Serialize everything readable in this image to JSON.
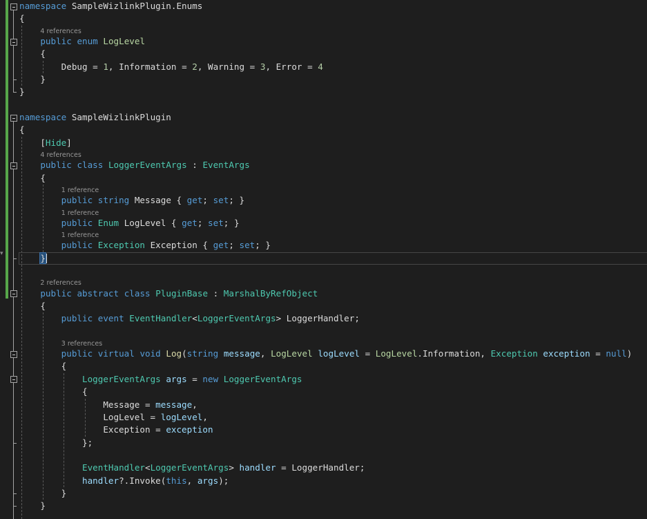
{
  "editor": {
    "colors": {
      "background": "#1e1e1e",
      "keyword": "#569cd6",
      "type": "#4ec9b0",
      "enum": "#b8d7a3",
      "method": "#dcdcaa",
      "identifier": "#9cdcfe",
      "number": "#b5cea8",
      "text": "#dcdcdc",
      "changed_bar": "#57a64a"
    },
    "current_line": 21,
    "lines": [
      {
        "type": "code",
        "fold": true,
        "tokens": [
          [
            "k",
            "namespace"
          ],
          [
            "d",
            " SampleWizlinkPlugin.Enums"
          ]
        ]
      },
      {
        "type": "code",
        "tokens": [
          [
            "d",
            "{"
          ]
        ]
      },
      {
        "type": "lens",
        "text": "    4 references"
      },
      {
        "type": "code",
        "fold": true,
        "tokens": [
          [
            "d",
            "    "
          ],
          [
            "k",
            "public"
          ],
          [
            "d",
            " "
          ],
          [
            "k",
            "enum"
          ],
          [
            "d",
            " "
          ],
          [
            "e",
            "LogLevel"
          ]
        ]
      },
      {
        "type": "code",
        "tokens": [
          [
            "d",
            "    {"
          ]
        ]
      },
      {
        "type": "code",
        "tokens": [
          [
            "d",
            "        Debug = "
          ],
          [
            "n",
            "1"
          ],
          [
            "d",
            ", Information = "
          ],
          [
            "n",
            "2"
          ],
          [
            "d",
            ", Warning = "
          ],
          [
            "n",
            "3"
          ],
          [
            "d",
            ", Error = "
          ],
          [
            "n",
            "4"
          ]
        ]
      },
      {
        "type": "code",
        "tokens": [
          [
            "d",
            "    }"
          ]
        ]
      },
      {
        "type": "code",
        "tokens": [
          [
            "d",
            "}"
          ]
        ]
      },
      {
        "type": "blank",
        "tokens": []
      },
      {
        "type": "code",
        "fold": true,
        "tokens": [
          [
            "k",
            "namespace"
          ],
          [
            "d",
            " SampleWizlinkPlugin"
          ]
        ]
      },
      {
        "type": "code",
        "tokens": [
          [
            "d",
            "{"
          ]
        ]
      },
      {
        "type": "code",
        "tokens": [
          [
            "d",
            "    ["
          ],
          [
            "t",
            "Hide"
          ],
          [
            "d",
            "]"
          ]
        ]
      },
      {
        "type": "lens",
        "text": "    4 references"
      },
      {
        "type": "code",
        "fold": true,
        "tokens": [
          [
            "d",
            "    "
          ],
          [
            "k",
            "public"
          ],
          [
            "d",
            " "
          ],
          [
            "k",
            "class"
          ],
          [
            "d",
            " "
          ],
          [
            "t",
            "LoggerEventArgs"
          ],
          [
            "d",
            " : "
          ],
          [
            "t",
            "EventArgs"
          ]
        ]
      },
      {
        "type": "code",
        "tokens": [
          [
            "d",
            "    {"
          ]
        ]
      },
      {
        "type": "lens",
        "text": "        1 reference"
      },
      {
        "type": "code",
        "tokens": [
          [
            "d",
            "        "
          ],
          [
            "k",
            "public"
          ],
          [
            "d",
            " "
          ],
          [
            "k",
            "string"
          ],
          [
            "d",
            " Message { "
          ],
          [
            "k",
            "get"
          ],
          [
            "d",
            "; "
          ],
          [
            "k",
            "set"
          ],
          [
            "d",
            "; }"
          ]
        ]
      },
      {
        "type": "lens",
        "text": "        1 reference"
      },
      {
        "type": "code",
        "tokens": [
          [
            "d",
            "        "
          ],
          [
            "k",
            "public"
          ],
          [
            "d",
            " "
          ],
          [
            "t",
            "Enum"
          ],
          [
            "d",
            " LogLevel { "
          ],
          [
            "k",
            "get"
          ],
          [
            "d",
            "; "
          ],
          [
            "k",
            "set"
          ],
          [
            "d",
            "; }"
          ]
        ]
      },
      {
        "type": "lens",
        "text": "        1 reference"
      },
      {
        "type": "code",
        "tokens": [
          [
            "d",
            "        "
          ],
          [
            "k",
            "public"
          ],
          [
            "d",
            " "
          ],
          [
            "t",
            "Exception"
          ],
          [
            "d",
            " Exception { "
          ],
          [
            "k",
            "get"
          ],
          [
            "d",
            "; "
          ],
          [
            "k",
            "set"
          ],
          [
            "d",
            "; }"
          ]
        ]
      },
      {
        "type": "code",
        "tokens": [
          [
            "d",
            "    "
          ],
          [
            "hl",
            "}"
          ]
        ]
      },
      {
        "type": "blank",
        "tokens": []
      },
      {
        "type": "lens",
        "text": "    2 references"
      },
      {
        "type": "code",
        "fold": true,
        "tokens": [
          [
            "d",
            "    "
          ],
          [
            "k",
            "public"
          ],
          [
            "d",
            " "
          ],
          [
            "k",
            "abstract"
          ],
          [
            "d",
            " "
          ],
          [
            "k",
            "class"
          ],
          [
            "d",
            " "
          ],
          [
            "t",
            "PluginBase"
          ],
          [
            "d",
            " : "
          ],
          [
            "t",
            "MarshalByRefObject"
          ]
        ]
      },
      {
        "type": "code",
        "tokens": [
          [
            "d",
            "    {"
          ]
        ]
      },
      {
        "type": "code",
        "tokens": [
          [
            "d",
            "        "
          ],
          [
            "k",
            "public"
          ],
          [
            "d",
            " "
          ],
          [
            "k",
            "event"
          ],
          [
            "d",
            " "
          ],
          [
            "t",
            "EventHandler"
          ],
          [
            "d",
            "<"
          ],
          [
            "t",
            "LoggerEventArgs"
          ],
          [
            "d",
            "> LoggerHandler;"
          ]
        ]
      },
      {
        "type": "blank",
        "tokens": []
      },
      {
        "type": "lens",
        "text": "        3 references"
      },
      {
        "type": "code",
        "fold": true,
        "tokens": [
          [
            "d",
            "        "
          ],
          [
            "k",
            "public"
          ],
          [
            "d",
            " "
          ],
          [
            "k",
            "virtual"
          ],
          [
            "d",
            " "
          ],
          [
            "k",
            "void"
          ],
          [
            "d",
            " "
          ],
          [
            "m",
            "Log"
          ],
          [
            "d",
            "("
          ],
          [
            "k",
            "string"
          ],
          [
            "d",
            " "
          ],
          [
            "p",
            "message"
          ],
          [
            "d",
            ", "
          ],
          [
            "e",
            "LogLevel"
          ],
          [
            "d",
            " "
          ],
          [
            "p",
            "logLevel"
          ],
          [
            "d",
            " = "
          ],
          [
            "e",
            "LogLevel"
          ],
          [
            "d",
            ".Information, "
          ],
          [
            "t",
            "Exception"
          ],
          [
            "d",
            " "
          ],
          [
            "p",
            "exception"
          ],
          [
            "d",
            " = "
          ],
          [
            "k",
            "null"
          ],
          [
            "d",
            ")"
          ]
        ]
      },
      {
        "type": "code",
        "tokens": [
          [
            "d",
            "        {"
          ]
        ]
      },
      {
        "type": "code",
        "fold": true,
        "tokens": [
          [
            "d",
            "            "
          ],
          [
            "t",
            "LoggerEventArgs"
          ],
          [
            "d",
            " "
          ],
          [
            "p",
            "args"
          ],
          [
            "d",
            " = "
          ],
          [
            "k",
            "new"
          ],
          [
            "d",
            " "
          ],
          [
            "t",
            "LoggerEventArgs"
          ]
        ]
      },
      {
        "type": "code",
        "tokens": [
          [
            "d",
            "            {"
          ]
        ]
      },
      {
        "type": "code",
        "tokens": [
          [
            "d",
            "                Message = "
          ],
          [
            "p",
            "message"
          ],
          [
            "d",
            ","
          ]
        ]
      },
      {
        "type": "code",
        "tokens": [
          [
            "d",
            "                LogLevel = "
          ],
          [
            "p",
            "logLevel"
          ],
          [
            "d",
            ","
          ]
        ]
      },
      {
        "type": "code",
        "tokens": [
          [
            "d",
            "                Exception = "
          ],
          [
            "p",
            "exception"
          ]
        ]
      },
      {
        "type": "code",
        "tokens": [
          [
            "d",
            "            };"
          ]
        ]
      },
      {
        "type": "blank",
        "tokens": []
      },
      {
        "type": "code",
        "tokens": [
          [
            "d",
            "            "
          ],
          [
            "t",
            "EventHandler"
          ],
          [
            "d",
            "<"
          ],
          [
            "t",
            "LoggerEventArgs"
          ],
          [
            "d",
            "> "
          ],
          [
            "p",
            "handler"
          ],
          [
            "d",
            " = LoggerHandler;"
          ]
        ]
      },
      {
        "type": "code",
        "tokens": [
          [
            "d",
            "            "
          ],
          [
            "p",
            "handler"
          ],
          [
            "d",
            "?.Invoke("
          ],
          [
            "k",
            "this"
          ],
          [
            "d",
            ", "
          ],
          [
            "p",
            "args"
          ],
          [
            "d",
            ");"
          ]
        ]
      },
      {
        "type": "code",
        "tokens": [
          [
            "d",
            "        }"
          ]
        ]
      },
      {
        "type": "code",
        "tokens": [
          [
            "d",
            "    }"
          ]
        ]
      }
    ]
  }
}
